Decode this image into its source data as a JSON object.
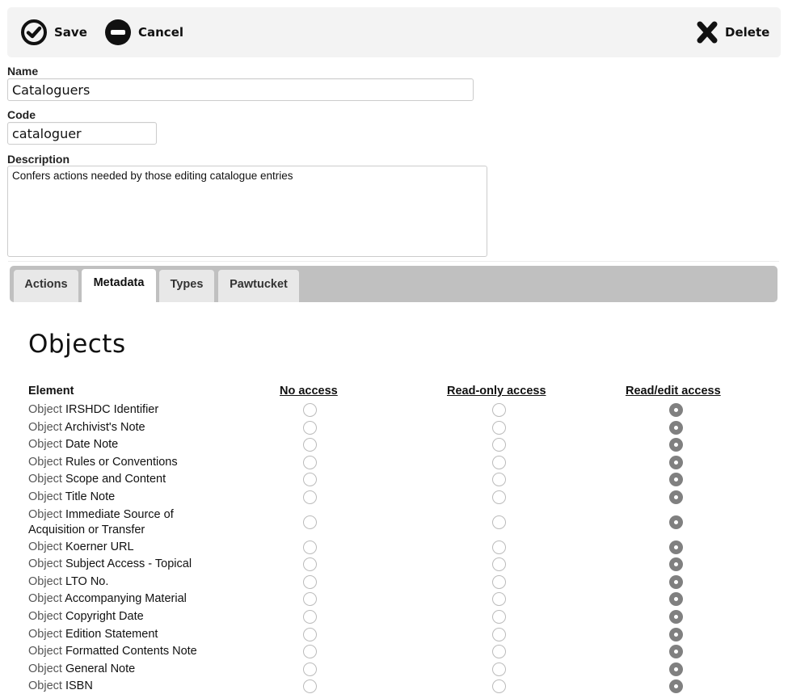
{
  "toolbar": {
    "save_label": "Save",
    "cancel_label": "Cancel",
    "delete_label": "Delete"
  },
  "form": {
    "name_label": "Name",
    "name_value": "Cataloguers",
    "code_label": "Code",
    "code_value": "cataloguer",
    "description_label": "Description",
    "description_value": "Confers actions needed by those editing catalogue entries"
  },
  "tabs": [
    {
      "label": "Actions",
      "active": false
    },
    {
      "label": "Metadata",
      "active": true
    },
    {
      "label": "Types",
      "active": false
    },
    {
      "label": "Pawtucket",
      "active": false
    }
  ],
  "section": {
    "title": "Objects",
    "columns": {
      "element": "Element",
      "no_access": "No access",
      "read_only": "Read-only access",
      "read_edit": "Read/edit access"
    },
    "row_prefix": "Object",
    "rows": [
      {
        "name": "IRSHDC Identifier",
        "access": "read_edit"
      },
      {
        "name": "Archivist's Note",
        "access": "read_edit"
      },
      {
        "name": "Date Note",
        "access": "read_edit"
      },
      {
        "name": "Rules or Conventions",
        "access": "read_edit"
      },
      {
        "name": "Scope and Content",
        "access": "read_edit"
      },
      {
        "name": "Title Note",
        "access": "read_edit"
      },
      {
        "name": "Immediate Source of Acquisition or Transfer",
        "access": "read_edit"
      },
      {
        "name": "Koerner URL",
        "access": "read_edit"
      },
      {
        "name": "Subject Access - Topical",
        "access": "read_edit"
      },
      {
        "name": "LTO No.",
        "access": "read_edit"
      },
      {
        "name": "Accompanying Material",
        "access": "read_edit"
      },
      {
        "name": "Copyright Date",
        "access": "read_edit"
      },
      {
        "name": "Edition Statement",
        "access": "read_edit"
      },
      {
        "name": "Formatted Contents Note",
        "access": "read_edit"
      },
      {
        "name": "General Note",
        "access": "read_edit"
      },
      {
        "name": "ISBN",
        "access": "read_edit"
      }
    ]
  }
}
